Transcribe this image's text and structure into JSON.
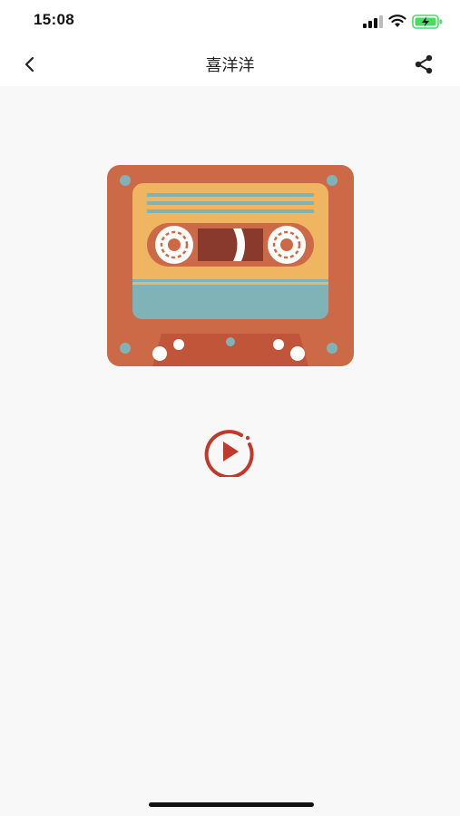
{
  "status_bar": {
    "time": "15:08"
  },
  "nav": {
    "title": "喜洋洋",
    "back_icon": "chevron-left-icon",
    "share_icon": "share-icon"
  },
  "content": {
    "artwork_icon": "cassette-tape",
    "play_icon": "play-circle-icon"
  },
  "colors": {
    "cassette_body": "#cc6a48",
    "cassette_label": "#efb561",
    "cassette_stripe": "#7fb3b8",
    "play_accent": "#c0392b",
    "background": "#f8f8f8"
  }
}
